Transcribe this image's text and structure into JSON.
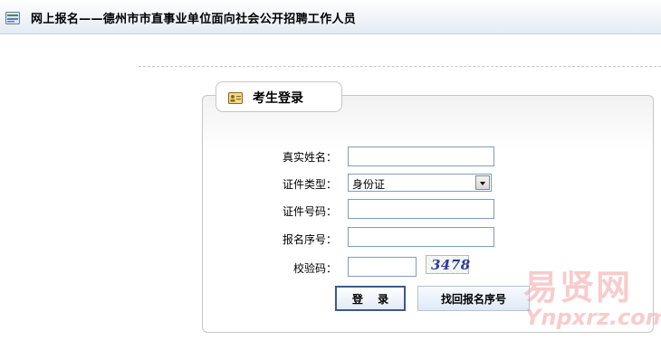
{
  "header": {
    "icon": "list-icon",
    "title": "网上报名——德州市市直事业单位面向社会公开招聘工作人员"
  },
  "login_panel": {
    "icon": "id-card-icon",
    "title": "考生登录",
    "fields": {
      "name_label": "真实姓名：",
      "name_value": "",
      "id_type_label": "证件类型：",
      "id_type_selected": "身份证",
      "id_number_label": "证件号码：",
      "id_number_value": "",
      "reg_no_label": "报名序号：",
      "reg_no_value": "",
      "captcha_label": "校验码：",
      "captcha_value": "",
      "captcha_image_text": "3478"
    },
    "buttons": {
      "login": "登 录",
      "find_reg_no": "找回报名序号"
    }
  },
  "watermark": {
    "cn": "易贤网",
    "en": "Ynpxrz.com"
  },
  "colors": {
    "input_border": "#7f9db9",
    "panel_border": "#c6c6c6",
    "captcha_text": "#2a3b9b",
    "watermark": "#f2a3a3"
  }
}
